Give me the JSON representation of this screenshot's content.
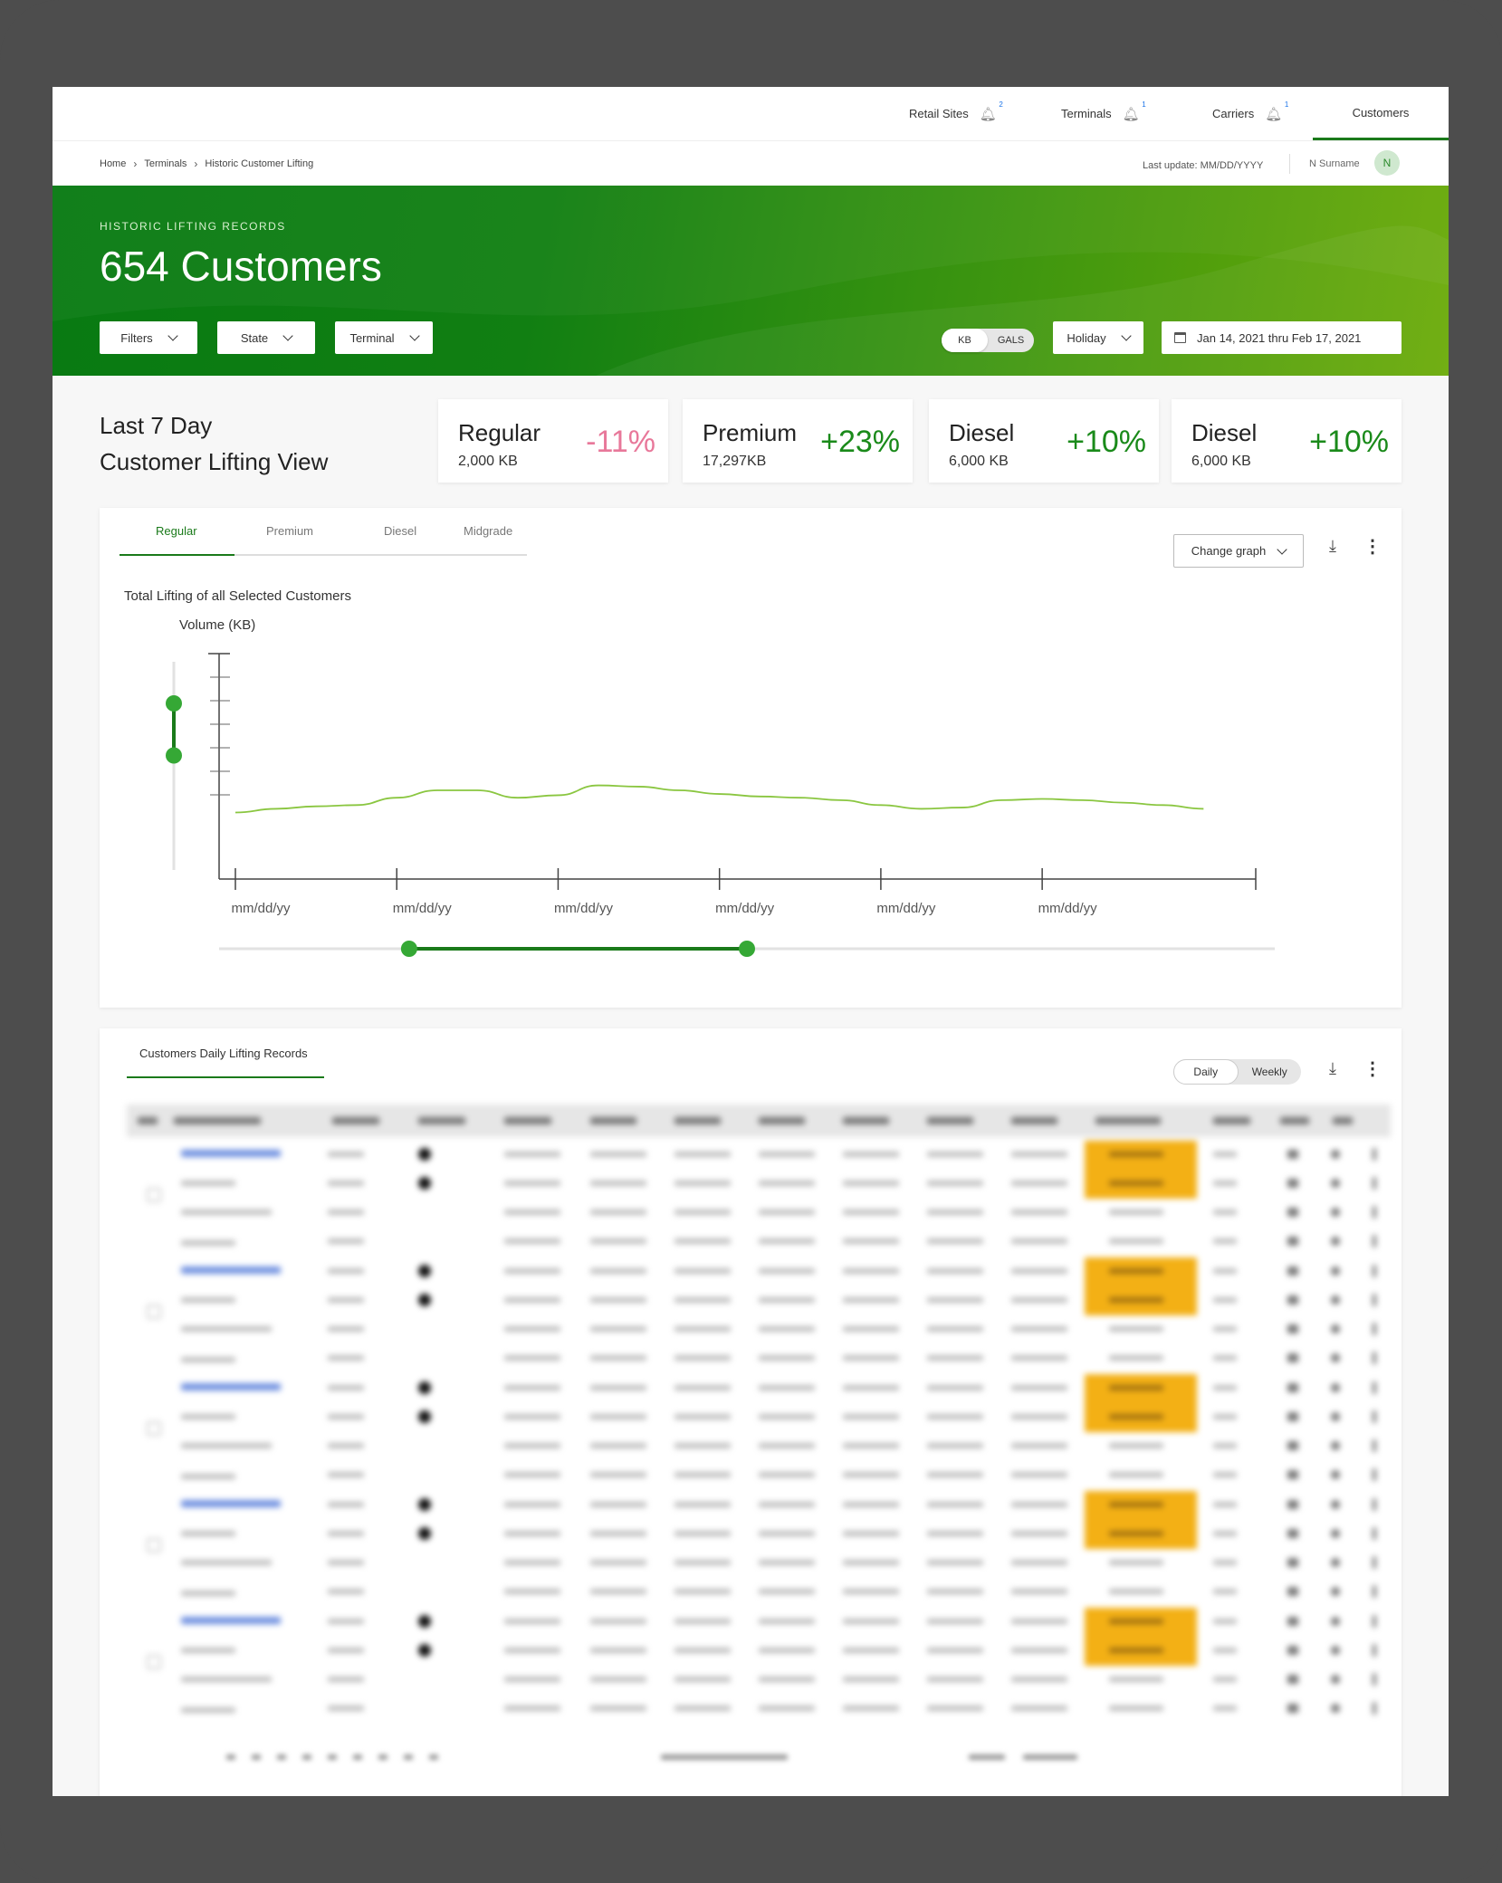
{
  "nav": {
    "items": [
      {
        "label": "Retail Sites",
        "badge": "2"
      },
      {
        "label": "Terminals",
        "badge": "1"
      },
      {
        "label": "Carriers",
        "badge": "1"
      },
      {
        "label": "Customers",
        "badge": ""
      }
    ],
    "active": "Customers"
  },
  "breadcrumb": [
    "Home",
    "Terminals",
    "Historic Customer Lifting"
  ],
  "last_update": "Last update: MM/DD/YYYY",
  "user": {
    "name": "N Surname",
    "initial": "N"
  },
  "hero": {
    "eyebrow": "HISTORIC LIFTING RECORDS",
    "title": "654 Customers",
    "filters": [
      "Filters",
      "State",
      "Terminal"
    ],
    "unit_toggle": {
      "options": [
        "KB",
        "GALS"
      ],
      "selected": "KB"
    },
    "holiday": "Holiday",
    "date_range": "Jan 14, 2021 thru Feb 17, 2021"
  },
  "summary": {
    "title_line1": "Last 7 Day",
    "title_line2": "Customer Lifting View",
    "stats": [
      {
        "name": "Regular",
        "value": "2,000 KB",
        "change": "-11%",
        "trend": "down"
      },
      {
        "name": "Premium",
        "value": "17,297KB",
        "change": "+23%",
        "trend": "up"
      },
      {
        "name": "Diesel",
        "value": "6,000 KB",
        "change": "+10%",
        "trend": "up"
      },
      {
        "name": "Diesel",
        "value": "6,000 KB",
        "change": "+10%",
        "trend": "up"
      }
    ]
  },
  "chart_card": {
    "tabs": [
      "Regular",
      "Premium",
      "Diesel",
      "Midgrade"
    ],
    "active_tab": "Regular",
    "change_graph_label": "Change graph",
    "subtitle": "Total Lifting of all Selected Customers"
  },
  "chart_data": {
    "type": "line",
    "title": "Total Lifting of all Selected Customers",
    "ylabel": "Volume (KB)",
    "xlabel": "",
    "x_tick_labels": [
      "mm/dd/yy",
      "mm/dd/yy",
      "mm/dd/yy",
      "mm/dd/yy",
      "mm/dd/yy",
      "mm/dd/yy"
    ],
    "x": [
      0,
      0.25,
      0.5,
      0.75,
      1,
      1.25,
      1.5,
      1.75,
      2,
      2.25,
      2.5,
      2.75,
      3,
      3.25,
      3.5,
      3.75,
      4,
      4.25,
      4.5,
      4.75,
      5,
      5.25,
      5.5,
      5.75,
      6
    ],
    "series": [
      {
        "values": [
          2.7,
          2.85,
          2.95,
          3.0,
          3.3,
          3.6,
          3.6,
          3.3,
          3.4,
          3.8,
          3.75,
          3.6,
          3.45,
          3.35,
          3.3,
          3.2,
          3.0,
          2.85,
          2.9,
          3.2,
          3.25,
          3.2,
          3.1,
          3.0,
          2.85
        ]
      }
    ],
    "ylim": [
      0,
      9
    ],
    "grid": false,
    "y_range_slider": [
      0.55,
      0.8
    ],
    "x_range_slider": [
      0.18,
      0.5
    ]
  },
  "table_card": {
    "title": "Customers Daily Lifting Records",
    "view_toggle": {
      "options": [
        "Daily",
        "Weekly"
      ],
      "selected": "Daily"
    }
  },
  "colors": {
    "accent": "#1a7a1a",
    "chart_line": "#8ac640",
    "negative": "#e8789a",
    "highlight": "#f3b015"
  }
}
